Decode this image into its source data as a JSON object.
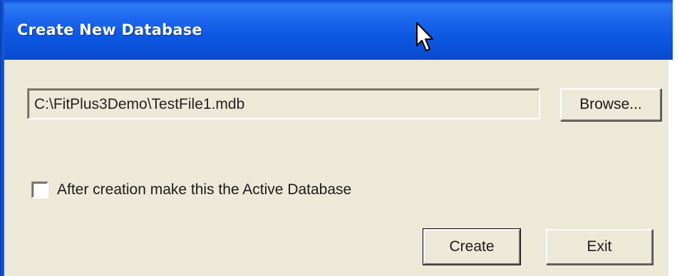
{
  "window": {
    "title": "Create New Database"
  },
  "path": {
    "value": "C:\\FitPlus3Demo\\TestFile1.mdb"
  },
  "buttons": {
    "browse": "Browse...",
    "create": "Create",
    "exit": "Exit"
  },
  "options": {
    "active_database_label": "After creation make this the Active Database",
    "active_database_checked": false
  },
  "colors": {
    "titlebar": "#0b50d6",
    "dialog_background": "#ece9d8",
    "title_text": "#ffffff"
  },
  "icons": {
    "cursor": "mouse-pointer-icon"
  }
}
